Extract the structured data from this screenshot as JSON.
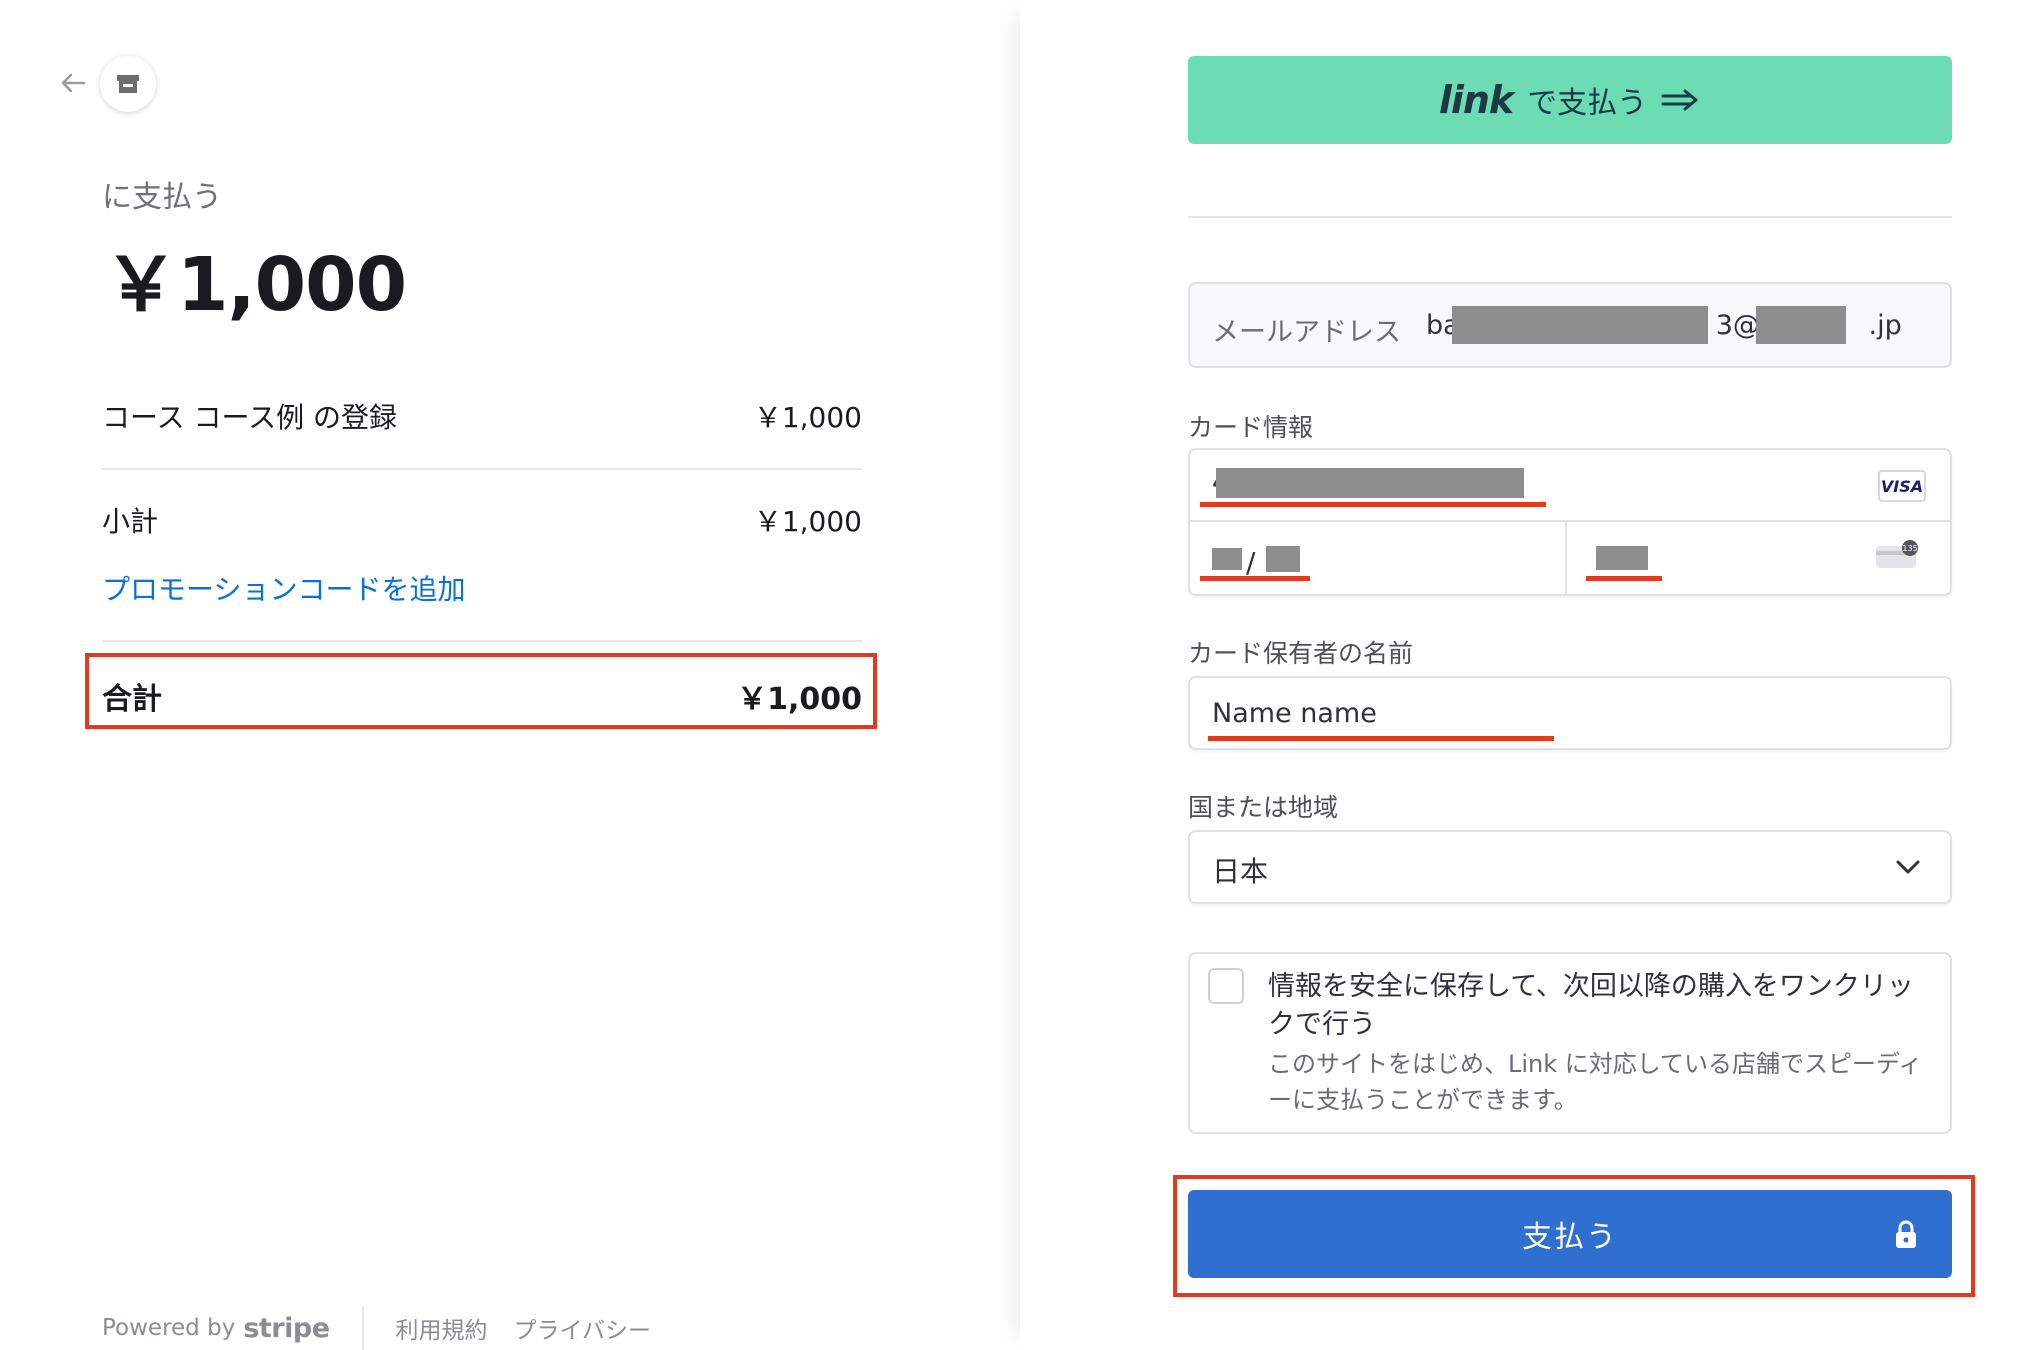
{
  "summary": {
    "pay_to": "に支払う",
    "amount": "￥1,000",
    "item": {
      "label": "コース コース例 の登録",
      "price": "￥1,000"
    },
    "subtotal": {
      "label": "小計",
      "price": "￥1,000"
    },
    "promo_link": "プロモーションコードを追加",
    "total": {
      "label": "合計",
      "price": "￥1,000"
    }
  },
  "footer": {
    "powered_by": "Powered by",
    "brand": "stripe",
    "terms": "利用規約",
    "privacy": "プライバシー"
  },
  "checkout": {
    "link_button": {
      "logo": "link",
      "label": "で支払う"
    },
    "email": {
      "label": "メールアドレス",
      "value_start": "ba",
      "value_mid": "3@e",
      "value_end": ".jp"
    },
    "card": {
      "label": "カード情報",
      "brand_badge": "VISA",
      "number_prefix": "4",
      "expiry_separator": "/",
      "cvc_badge": "135"
    },
    "cardholder": {
      "label": "カード保有者の名前",
      "value": "Name name"
    },
    "country": {
      "label": "国または地域",
      "value": "日本"
    },
    "save_info": {
      "title": "情報を安全に保存して、次回以降の購入をワンクリックで行う",
      "description": "このサイトをはじめ、Link に対応している店舗でスピーディーに支払うことができます。"
    },
    "pay_button": "支払う"
  },
  "colors": {
    "link_green": "#6cdcb5",
    "pay_blue": "#2f6fcf",
    "annotation_red": "#e03a21",
    "promo_blue": "#0570de"
  }
}
